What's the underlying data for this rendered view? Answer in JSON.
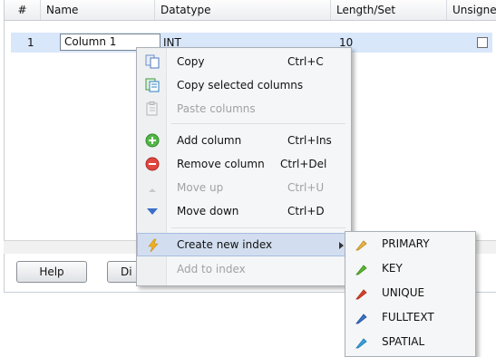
{
  "table": {
    "columns": [
      "#",
      "Name",
      "Datatype",
      "Length/Set",
      "Unsigned"
    ],
    "row": {
      "num": "1",
      "name": "Column 1",
      "datatype": "INT",
      "length": "10",
      "unsigned_checked": false
    }
  },
  "buttons": {
    "help": "Help",
    "di": "Di"
  },
  "context_menu": {
    "items": [
      {
        "label": "Copy",
        "shortcut": "Ctrl+C",
        "icon": "copy-icon",
        "enabled": true
      },
      {
        "label": "Copy selected columns",
        "shortcut": "",
        "icon": "copy-columns-icon",
        "enabled": true
      },
      {
        "label": "Paste columns",
        "shortcut": "",
        "icon": "paste-icon",
        "enabled": false
      },
      {
        "label": "Add column",
        "shortcut": "Ctrl+Ins",
        "icon": "add-icon",
        "enabled": true
      },
      {
        "label": "Remove column",
        "shortcut": "Ctrl+Del",
        "icon": "remove-icon",
        "enabled": true
      },
      {
        "label": "Move up",
        "shortcut": "Ctrl+U",
        "icon": "arrow-up-icon",
        "enabled": false
      },
      {
        "label": "Move down",
        "shortcut": "Ctrl+D",
        "icon": "arrow-down-icon",
        "enabled": true
      },
      {
        "label": "Create new index",
        "shortcut": "",
        "icon": "lightning-icon",
        "enabled": true,
        "has_submenu": true
      },
      {
        "label": "Add to index",
        "shortcut": "",
        "icon": "",
        "enabled": false
      }
    ]
  },
  "index_submenu": {
    "items": [
      {
        "label": "PRIMARY",
        "icon": "key-icon",
        "color": "#e8b64a"
      },
      {
        "label": "KEY",
        "icon": "key-icon",
        "color": "#5cb531"
      },
      {
        "label": "UNIQUE",
        "icon": "key-icon",
        "color": "#d8442a"
      },
      {
        "label": "FULLTEXT",
        "icon": "key-icon",
        "color": "#3a72c8"
      },
      {
        "label": "SPATIAL",
        "icon": "key-icon",
        "color": "#3aa0d8"
      }
    ]
  },
  "colors": {
    "selection": "#d9e7fb",
    "menu_bg": "#f5f6f7",
    "highlight": "#d2def0"
  }
}
